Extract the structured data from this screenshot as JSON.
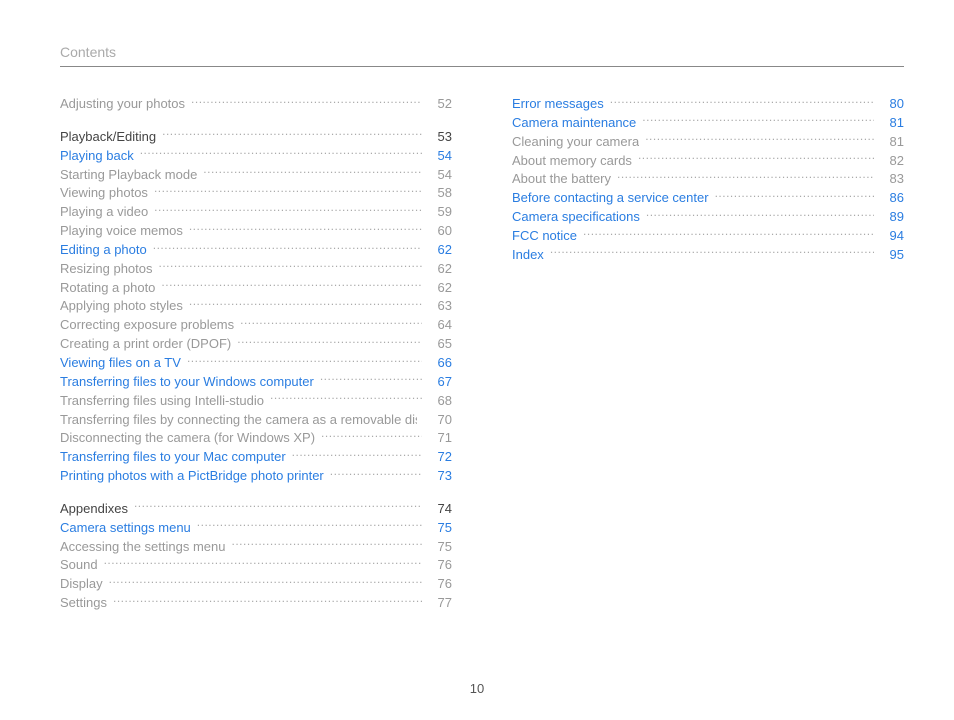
{
  "header": "Contents",
  "page_number": "10",
  "left_column": [
    {
      "kind": "row",
      "style": "plain",
      "label": "Adjusting your photos",
      "page": "52"
    },
    {
      "kind": "gap"
    },
    {
      "kind": "row",
      "style": "heading",
      "label": "Playback/Editing",
      "page": "53"
    },
    {
      "kind": "row",
      "style": "link",
      "label": "Playing back",
      "page": "54"
    },
    {
      "kind": "row",
      "style": "plain",
      "label": "Starting Playback mode",
      "page": "54"
    },
    {
      "kind": "row",
      "style": "plain",
      "label": "Viewing photos",
      "page": "58"
    },
    {
      "kind": "row",
      "style": "plain",
      "label": "Playing a video",
      "page": "59"
    },
    {
      "kind": "row",
      "style": "plain",
      "label": "Playing voice memos",
      "page": "60"
    },
    {
      "kind": "row",
      "style": "link",
      "label": "Editing a photo",
      "page": "62"
    },
    {
      "kind": "row",
      "style": "plain",
      "label": "Resizing photos",
      "page": "62"
    },
    {
      "kind": "row",
      "style": "plain",
      "label": "Rotating a photo",
      "page": "62"
    },
    {
      "kind": "row",
      "style": "plain",
      "label": "Applying photo styles",
      "page": "63"
    },
    {
      "kind": "row",
      "style": "plain",
      "label": "Correcting exposure problems",
      "page": "64"
    },
    {
      "kind": "row",
      "style": "plain",
      "label": "Creating a print order (DPOF)",
      "page": "65"
    },
    {
      "kind": "row",
      "style": "link",
      "label": "Viewing files on a TV",
      "page": "66"
    },
    {
      "kind": "row",
      "style": "link",
      "label": "Transferring files to your Windows computer",
      "page": "67"
    },
    {
      "kind": "row",
      "style": "plain",
      "label": "Transferring files using Intelli-studio",
      "page": "68"
    },
    {
      "kind": "row",
      "style": "plain",
      "label": "Transferring files by connecting the camera as a removable disk",
      "page": "70"
    },
    {
      "kind": "row",
      "style": "plain",
      "label": "Disconnecting the camera (for Windows XP)",
      "page": "71"
    },
    {
      "kind": "row",
      "style": "link",
      "label": "Transferring files to your Mac computer",
      "page": "72"
    },
    {
      "kind": "row",
      "style": "link",
      "label": "Printing photos with a PictBridge photo printer",
      "page": "73"
    },
    {
      "kind": "gap"
    },
    {
      "kind": "row",
      "style": "heading",
      "label": "Appendixes",
      "page": "74"
    },
    {
      "kind": "row",
      "style": "link",
      "label": "Camera settings menu",
      "page": "75"
    },
    {
      "kind": "row",
      "style": "plain",
      "label": "Accessing the settings menu",
      "page": "75"
    },
    {
      "kind": "row",
      "style": "plain",
      "label": "Sound",
      "page": "76"
    },
    {
      "kind": "row",
      "style": "plain",
      "label": "Display",
      "page": "76"
    },
    {
      "kind": "row",
      "style": "plain",
      "label": "Settings",
      "page": "77"
    }
  ],
  "right_column": [
    {
      "kind": "row",
      "style": "link",
      "label": "Error messages",
      "page": "80"
    },
    {
      "kind": "row",
      "style": "link",
      "label": "Camera maintenance",
      "page": "81"
    },
    {
      "kind": "row",
      "style": "plain",
      "label": "Cleaning your camera",
      "page": "81"
    },
    {
      "kind": "row",
      "style": "plain",
      "label": "About memory cards",
      "page": "82"
    },
    {
      "kind": "row",
      "style": "plain",
      "label": "About the battery",
      "page": "83"
    },
    {
      "kind": "row",
      "style": "link",
      "label": "Before contacting a service center",
      "page": "86"
    },
    {
      "kind": "row",
      "style": "link",
      "label": "Camera specifications",
      "page": "89"
    },
    {
      "kind": "row",
      "style": "link",
      "label": "FCC notice",
      "page": "94"
    },
    {
      "kind": "row",
      "style": "link",
      "label": "Index",
      "page": "95"
    }
  ]
}
